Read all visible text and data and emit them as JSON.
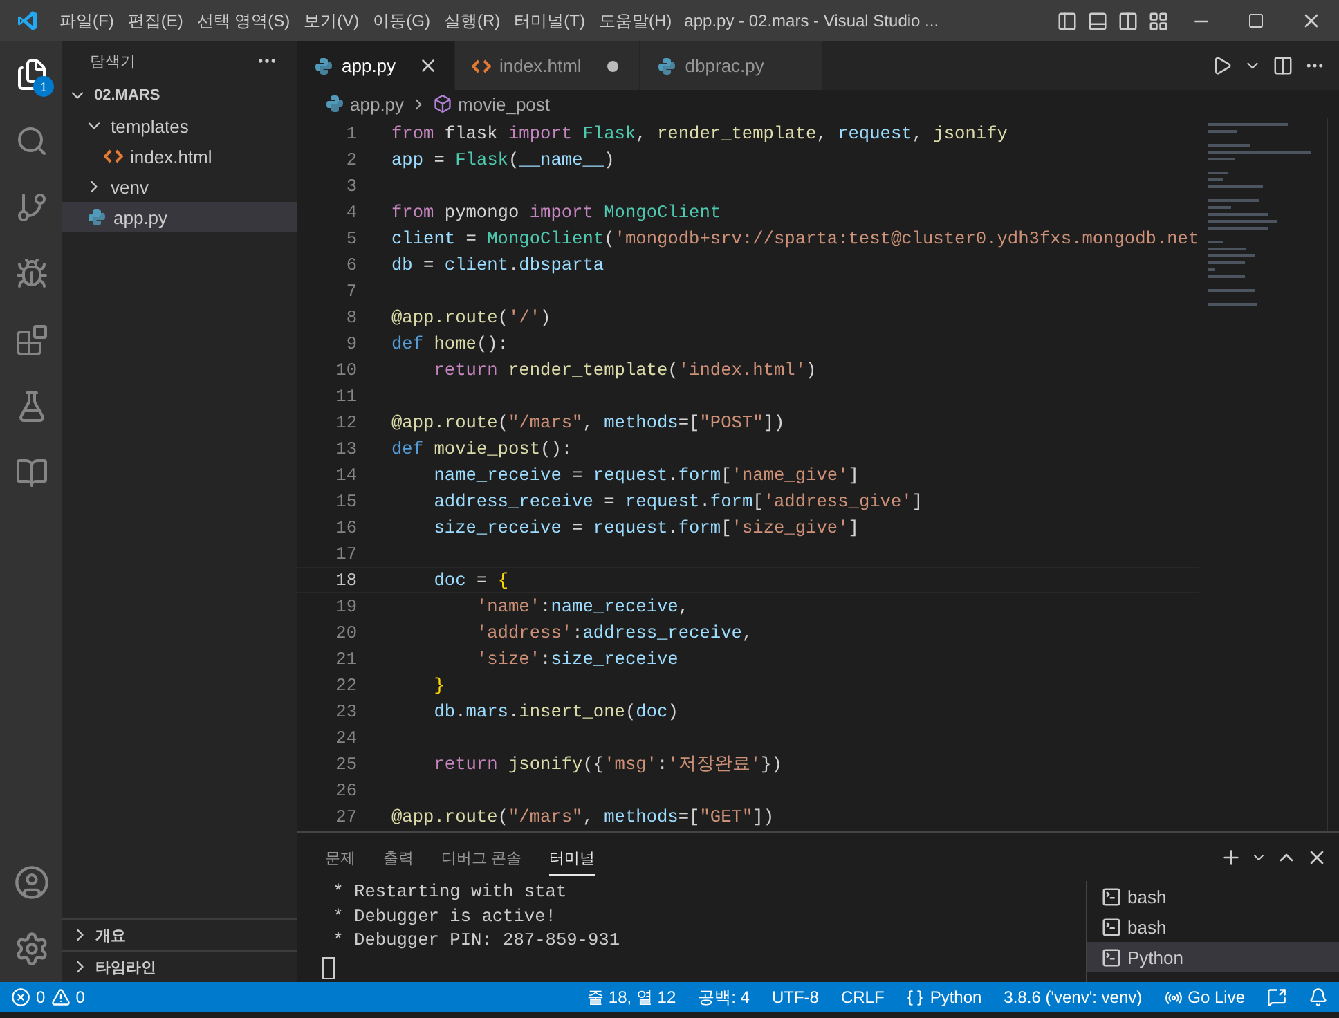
{
  "window": {
    "title": "app.py - 02.mars - Visual Studio ..."
  },
  "menu": [
    "파일(F)",
    "편집(E)",
    "선택 영역(S)",
    "보기(V)",
    "이동(G)",
    "실행(R)",
    "터미널(T)",
    "도움말(H)"
  ],
  "activity_bar": {
    "explorer_badge": "1"
  },
  "sidebar": {
    "title": "탐색기",
    "root": {
      "label": "02.MARS",
      "expanded": true
    },
    "tree": [
      {
        "label": "templates",
        "kind": "folder",
        "expanded": true,
        "selected": false,
        "children": [
          {
            "label": "index.html",
            "kind": "html",
            "selected": false
          }
        ]
      },
      {
        "label": "venv",
        "kind": "folder",
        "expanded": false,
        "selected": false
      },
      {
        "label": "app.py",
        "kind": "python",
        "selected": true
      }
    ],
    "sections": [
      "개요",
      "타임라인"
    ]
  },
  "tabs": [
    {
      "label": "app.py",
      "kind": "python",
      "selected": true,
      "modified": false
    },
    {
      "label": "index.html",
      "kind": "html",
      "selected": false,
      "modified": true
    },
    {
      "label": "dbprac.py",
      "kind": "python",
      "selected": false,
      "modified": false
    }
  ],
  "breadcrumbs": {
    "file": "app.py",
    "symbol": "movie_post"
  },
  "code": [
    {
      "number": "1",
      "current": false,
      "tokens": [
        {
          "color": "#c586c0",
          "t": "from"
        },
        {
          "color": "#d4d4d4",
          "t": " flask "
        },
        {
          "color": "#c586c0",
          "t": "import"
        },
        {
          "color": "#4ec9b0",
          "t": " Flask"
        },
        {
          "color": "#d4d4d4",
          "t": ", "
        },
        {
          "color": "#dcdcaa",
          "t": "render_template"
        },
        {
          "color": "#d4d4d4",
          "t": ", "
        },
        {
          "color": "#9cdcfe",
          "t": "request"
        },
        {
          "color": "#d4d4d4",
          "t": ", "
        },
        {
          "color": "#dcdcaa",
          "t": "jsonify"
        }
      ]
    },
    {
      "number": "2",
      "current": false,
      "tokens": [
        {
          "color": "#9cdcfe",
          "t": "app"
        },
        {
          "color": "#d4d4d4",
          "t": " = "
        },
        {
          "color": "#4ec9b0",
          "t": "Flask"
        },
        {
          "color": "#d4d4d4",
          "t": "("
        },
        {
          "color": "#9cdcfe",
          "t": "__name__"
        },
        {
          "color": "#d4d4d4",
          "t": ")"
        }
      ]
    },
    {
      "number": "3",
      "current": false
    },
    {
      "number": "4",
      "current": false,
      "tokens": [
        {
          "color": "#c586c0",
          "t": "from"
        },
        {
          "color": "#d4d4d4",
          "t": " pymongo "
        },
        {
          "color": "#c586c0",
          "t": "import"
        },
        {
          "color": "#4ec9b0",
          "t": " MongoClient"
        }
      ]
    },
    {
      "number": "5",
      "current": false,
      "tokens": [
        {
          "color": "#9cdcfe",
          "t": "client"
        },
        {
          "color": "#d4d4d4",
          "t": " = "
        },
        {
          "color": "#4ec9b0",
          "t": "MongoClient"
        },
        {
          "color": "#d4d4d4",
          "t": "("
        },
        {
          "color": "#ce9178",
          "t": "'mongodb+srv://sparta:test@cluster0.ydh3fxs.mongodb.net"
        }
      ]
    },
    {
      "number": "6",
      "current": false,
      "tokens": [
        {
          "color": "#9cdcfe",
          "t": "db"
        },
        {
          "color": "#d4d4d4",
          "t": " = "
        },
        {
          "color": "#9cdcfe",
          "t": "client"
        },
        {
          "color": "#d4d4d4",
          "t": "."
        },
        {
          "color": "#9cdcfe",
          "t": "dbsparta"
        }
      ]
    },
    {
      "number": "7",
      "current": false
    },
    {
      "number": "8",
      "current": false,
      "tokens": [
        {
          "color": "#dcdcaa",
          "t": "@app.route"
        },
        {
          "color": "#d4d4d4",
          "t": "("
        },
        {
          "color": "#ce9178",
          "t": "'/'"
        },
        {
          "color": "#d4d4d4",
          "t": ")"
        }
      ]
    },
    {
      "number": "9",
      "current": false,
      "tokens": [
        {
          "color": "#569cd6",
          "t": "def"
        },
        {
          "color": "#dcdcaa",
          "t": " home"
        },
        {
          "color": "#d4d4d4",
          "t": "():"
        }
      ]
    },
    {
      "number": "10",
      "current": false,
      "tokens": [
        {
          "color": "#c586c0",
          "t": "    return"
        },
        {
          "color": "#dcdcaa",
          "t": " render_template"
        },
        {
          "color": "#d4d4d4",
          "t": "("
        },
        {
          "color": "#ce9178",
          "t": "'index.html'"
        },
        {
          "color": "#d4d4d4",
          "t": ")"
        }
      ]
    },
    {
      "number": "11",
      "current": false
    },
    {
      "number": "12",
      "current": false,
      "tokens": [
        {
          "color": "#dcdcaa",
          "t": "@app.route"
        },
        {
          "color": "#d4d4d4",
          "t": "("
        },
        {
          "color": "#ce9178",
          "t": "\"/mars\""
        },
        {
          "color": "#d4d4d4",
          "t": ", "
        },
        {
          "color": "#9cdcfe",
          "t": "methods"
        },
        {
          "color": "#d4d4d4",
          "t": "=["
        },
        {
          "color": "#ce9178",
          "t": "\"POST\""
        },
        {
          "color": "#d4d4d4",
          "t": "])"
        }
      ]
    },
    {
      "number": "13",
      "current": false,
      "tokens": [
        {
          "color": "#569cd6",
          "t": "def"
        },
        {
          "color": "#dcdcaa",
          "t": " movie_post"
        },
        {
          "color": "#d4d4d4",
          "t": "():"
        }
      ]
    },
    {
      "number": "14",
      "current": false,
      "tokens": [
        {
          "color": "#9cdcfe",
          "t": "    name_receive"
        },
        {
          "color": "#d4d4d4",
          "t": " = "
        },
        {
          "color": "#9cdcfe",
          "t": "request"
        },
        {
          "color": "#d4d4d4",
          "t": "."
        },
        {
          "color": "#9cdcfe",
          "t": "form"
        },
        {
          "color": "#d4d4d4",
          "t": "["
        },
        {
          "color": "#ce9178",
          "t": "'name_give'"
        },
        {
          "color": "#d4d4d4",
          "t": "]"
        }
      ]
    },
    {
      "number": "15",
      "current": false,
      "tokens": [
        {
          "color": "#9cdcfe",
          "t": "    address_receive"
        },
        {
          "color": "#d4d4d4",
          "t": " = "
        },
        {
          "color": "#9cdcfe",
          "t": "request"
        },
        {
          "color": "#d4d4d4",
          "t": "."
        },
        {
          "color": "#9cdcfe",
          "t": "form"
        },
        {
          "color": "#d4d4d4",
          "t": "["
        },
        {
          "color": "#ce9178",
          "t": "'address_give'"
        },
        {
          "color": "#d4d4d4",
          "t": "]"
        }
      ]
    },
    {
      "number": "16",
      "current": false,
      "tokens": [
        {
          "color": "#9cdcfe",
          "t": "    size_receive"
        },
        {
          "color": "#d4d4d4",
          "t": " = "
        },
        {
          "color": "#9cdcfe",
          "t": "request"
        },
        {
          "color": "#d4d4d4",
          "t": "."
        },
        {
          "color": "#9cdcfe",
          "t": "form"
        },
        {
          "color": "#d4d4d4",
          "t": "["
        },
        {
          "color": "#ce9178",
          "t": "'size_give'"
        },
        {
          "color": "#d4d4d4",
          "t": "]"
        }
      ]
    },
    {
      "number": "17",
      "current": false
    },
    {
      "number": "18",
      "current": true,
      "tokens": [
        {
          "color": "#9cdcfe",
          "t": "    doc"
        },
        {
          "color": "#d4d4d4",
          "t": " = "
        },
        {
          "color": "#ffd700",
          "t": "{"
        }
      ]
    },
    {
      "number": "19",
      "current": false,
      "tokens": [
        {
          "color": "#ce9178",
          "t": "        'name'"
        },
        {
          "color": "#d4d4d4",
          "t": ":"
        },
        {
          "color": "#9cdcfe",
          "t": "name_receive"
        },
        {
          "color": "#d4d4d4",
          "t": ","
        }
      ]
    },
    {
      "number": "20",
      "current": false,
      "tokens": [
        {
          "color": "#ce9178",
          "t": "        'address'"
        },
        {
          "color": "#d4d4d4",
          "t": ":"
        },
        {
          "color": "#9cdcfe",
          "t": "address_receive"
        },
        {
          "color": "#d4d4d4",
          "t": ","
        }
      ]
    },
    {
      "number": "21",
      "current": false,
      "tokens": [
        {
          "color": "#ce9178",
          "t": "        'size'"
        },
        {
          "color": "#d4d4d4",
          "t": ":"
        },
        {
          "color": "#9cdcfe",
          "t": "size_receive"
        }
      ]
    },
    {
      "number": "22",
      "current": false,
      "tokens": [
        {
          "color": "#ffd700",
          "t": "    }"
        }
      ]
    },
    {
      "number": "23",
      "current": false,
      "tokens": [
        {
          "color": "#9cdcfe",
          "t": "    db"
        },
        {
          "color": "#d4d4d4",
          "t": "."
        },
        {
          "color": "#9cdcfe",
          "t": "mars"
        },
        {
          "color": "#d4d4d4",
          "t": "."
        },
        {
          "color": "#dcdcaa",
          "t": "insert_one"
        },
        {
          "color": "#d4d4d4",
          "t": "("
        },
        {
          "color": "#9cdcfe",
          "t": "doc"
        },
        {
          "color": "#d4d4d4",
          "t": ")"
        }
      ]
    },
    {
      "number": "24",
      "current": false
    },
    {
      "number": "25",
      "current": false,
      "tokens": [
        {
          "color": "#c586c0",
          "t": "    return"
        },
        {
          "color": "#dcdcaa",
          "t": " jsonify"
        },
        {
          "color": "#d4d4d4",
          "t": "({"
        },
        {
          "color": "#ce9178",
          "t": "'msg'"
        },
        {
          "color": "#d4d4d4",
          "t": ":"
        },
        {
          "color": "#ce9178",
          "t": "'저장완료'"
        },
        {
          "color": "#d4d4d4",
          "t": "})"
        }
      ]
    },
    {
      "number": "26",
      "current": false
    },
    {
      "number": "27",
      "current": false,
      "tokens": [
        {
          "color": "#dcdcaa",
          "t": "@app.route"
        },
        {
          "color": "#d4d4d4",
          "t": "("
        },
        {
          "color": "#ce9178",
          "t": "\"/mars\""
        },
        {
          "color": "#d4d4d4",
          "t": ", "
        },
        {
          "color": "#9cdcfe",
          "t": "methods"
        },
        {
          "color": "#d4d4d4",
          "t": "=["
        },
        {
          "color": "#ce9178",
          "t": "\"GET\""
        },
        {
          "color": "#d4d4d4",
          "t": "])"
        }
      ]
    }
  ],
  "panel": {
    "tabs": [
      {
        "label": "문제",
        "selected": false
      },
      {
        "label": "출력",
        "selected": false
      },
      {
        "label": "디버그 콘솔",
        "selected": false
      },
      {
        "label": "터미널",
        "selected": true
      }
    ],
    "terminal_lines": [
      " * Restarting with stat",
      " * Debugger is active!",
      " * Debugger PIN: 287-859-931"
    ],
    "terminals": [
      {
        "label": "bash",
        "selected": false
      },
      {
        "label": "bash",
        "selected": false
      },
      {
        "label": "Python",
        "selected": true
      }
    ]
  },
  "status_bar": {
    "errors": "0",
    "warnings": "0",
    "position": "줄 18, 열 12",
    "indent": "공백: 4",
    "encoding": "UTF-8",
    "eol": "CRLF",
    "language": "Python",
    "interpreter": "3.8.6 ('venv': venv)",
    "live": "Go Live"
  }
}
